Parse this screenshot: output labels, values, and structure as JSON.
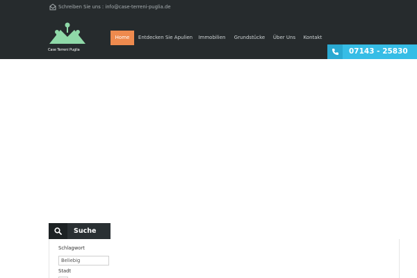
{
  "topbar": {
    "mail_text": "Schreiben Sie uns : info@case-terreni-puglia.de"
  },
  "logo": {
    "text": "Case Terreni Puglia",
    "color": "#8fd9a8"
  },
  "nav": {
    "items": [
      {
        "label": "Home",
        "active": true
      },
      {
        "label": "Entdecken Sie Apulien",
        "active": false
      },
      {
        "label": "Immobilien",
        "active": false
      },
      {
        "label": "Grundstücke",
        "active": false
      },
      {
        "label": "Über Uns",
        "active": false
      },
      {
        "label": "Kontakt",
        "active": false
      }
    ],
    "active_color": "#ee8a4e"
  },
  "phone": {
    "number": "07143 - 25830",
    "color": "#36bde6"
  },
  "search": {
    "title": "Suche",
    "keyword_label": "Schlagwort",
    "keyword_value": "Beliebig",
    "city_label": "Stadt"
  },
  "icons": {
    "mail": "envelope-icon",
    "phone": "phone-icon",
    "search": "search-icon"
  }
}
